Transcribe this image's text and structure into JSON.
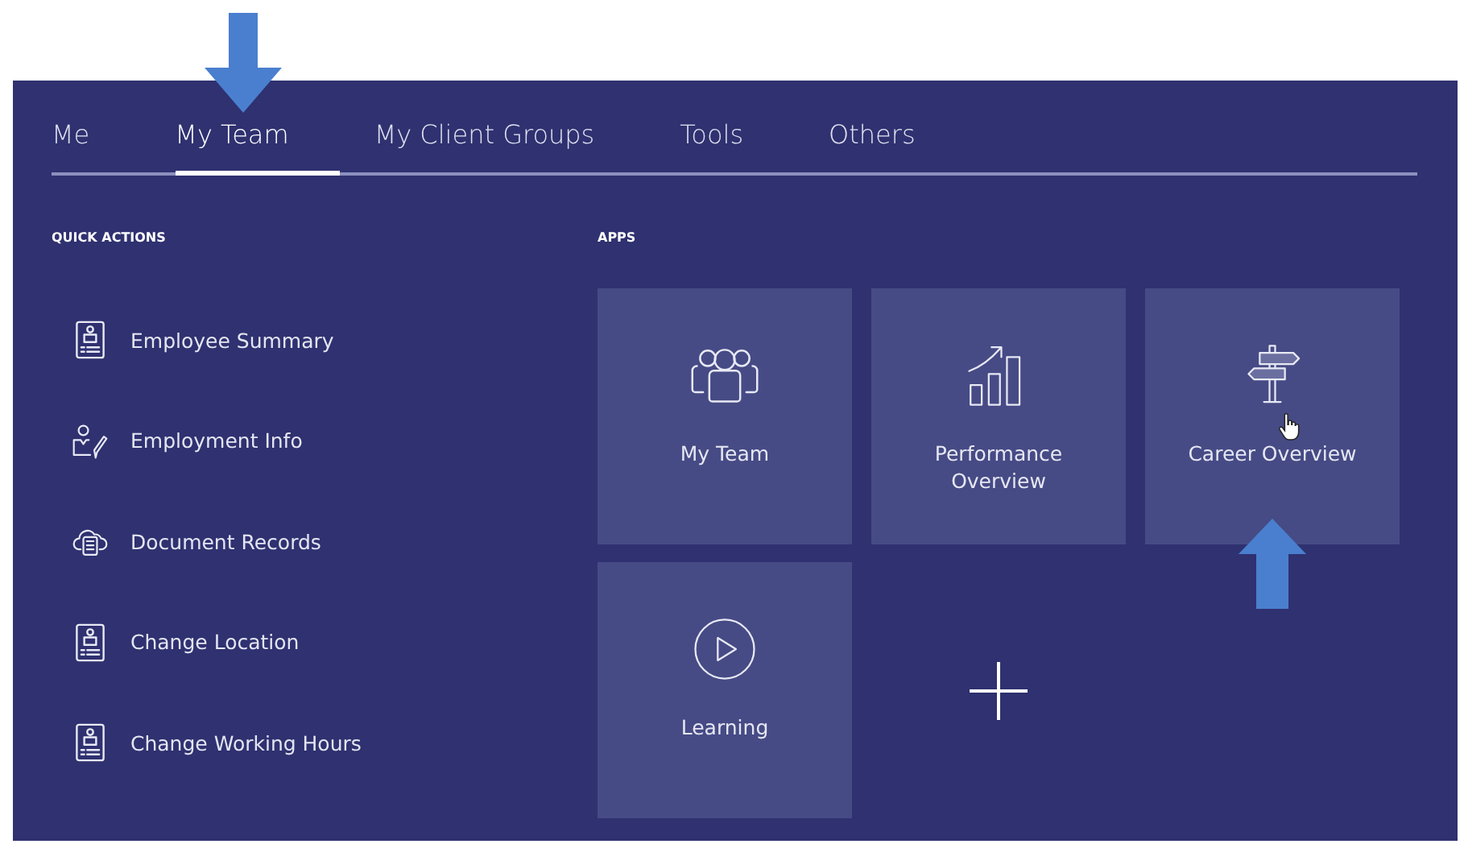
{
  "tabs": [
    {
      "label": "Me",
      "selected": false
    },
    {
      "label": "My Team",
      "selected": true
    },
    {
      "label": "My Client Groups",
      "selected": false
    },
    {
      "label": "Tools",
      "selected": false
    },
    {
      "label": "Others",
      "selected": false
    }
  ],
  "quick_actions": {
    "heading": "QUICK ACTIONS",
    "items": [
      {
        "label": "Employee Summary"
      },
      {
        "label": "Employment Info"
      },
      {
        "label": "Document Records"
      },
      {
        "label": "Change Location"
      },
      {
        "label": "Change Working Hours"
      }
    ]
  },
  "apps": {
    "heading": "APPS",
    "tiles": [
      {
        "kind": "app",
        "label": "My Team"
      },
      {
        "kind": "app",
        "label": "Performance Overview"
      },
      {
        "kind": "app",
        "label": "Career Overview"
      },
      {
        "kind": "app",
        "label": "Learning"
      },
      {
        "kind": "add"
      }
    ]
  }
}
